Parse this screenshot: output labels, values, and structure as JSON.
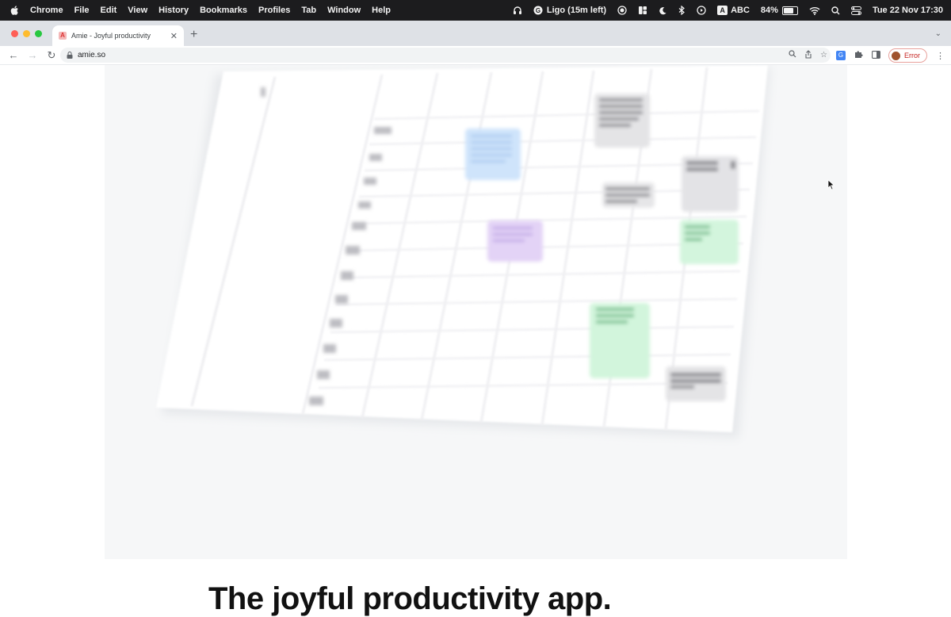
{
  "menubar": {
    "app_name": "Chrome",
    "items": [
      "File",
      "Edit",
      "View",
      "History",
      "Bookmarks",
      "Profiles",
      "Tab",
      "Window",
      "Help"
    ],
    "status": {
      "meeting": "Ligo (15m left)",
      "input_source": "ABC",
      "battery": "84%",
      "battery_level": 0.84,
      "datetime": "Tue 22 Nov  17:30"
    }
  },
  "browser": {
    "tab": {
      "title": "Amie - Joyful productivity",
      "favicon_letter": "A"
    },
    "url": "amie.so",
    "profile_status": "Error"
  },
  "page": {
    "headline": "The joyful productivity app."
  }
}
